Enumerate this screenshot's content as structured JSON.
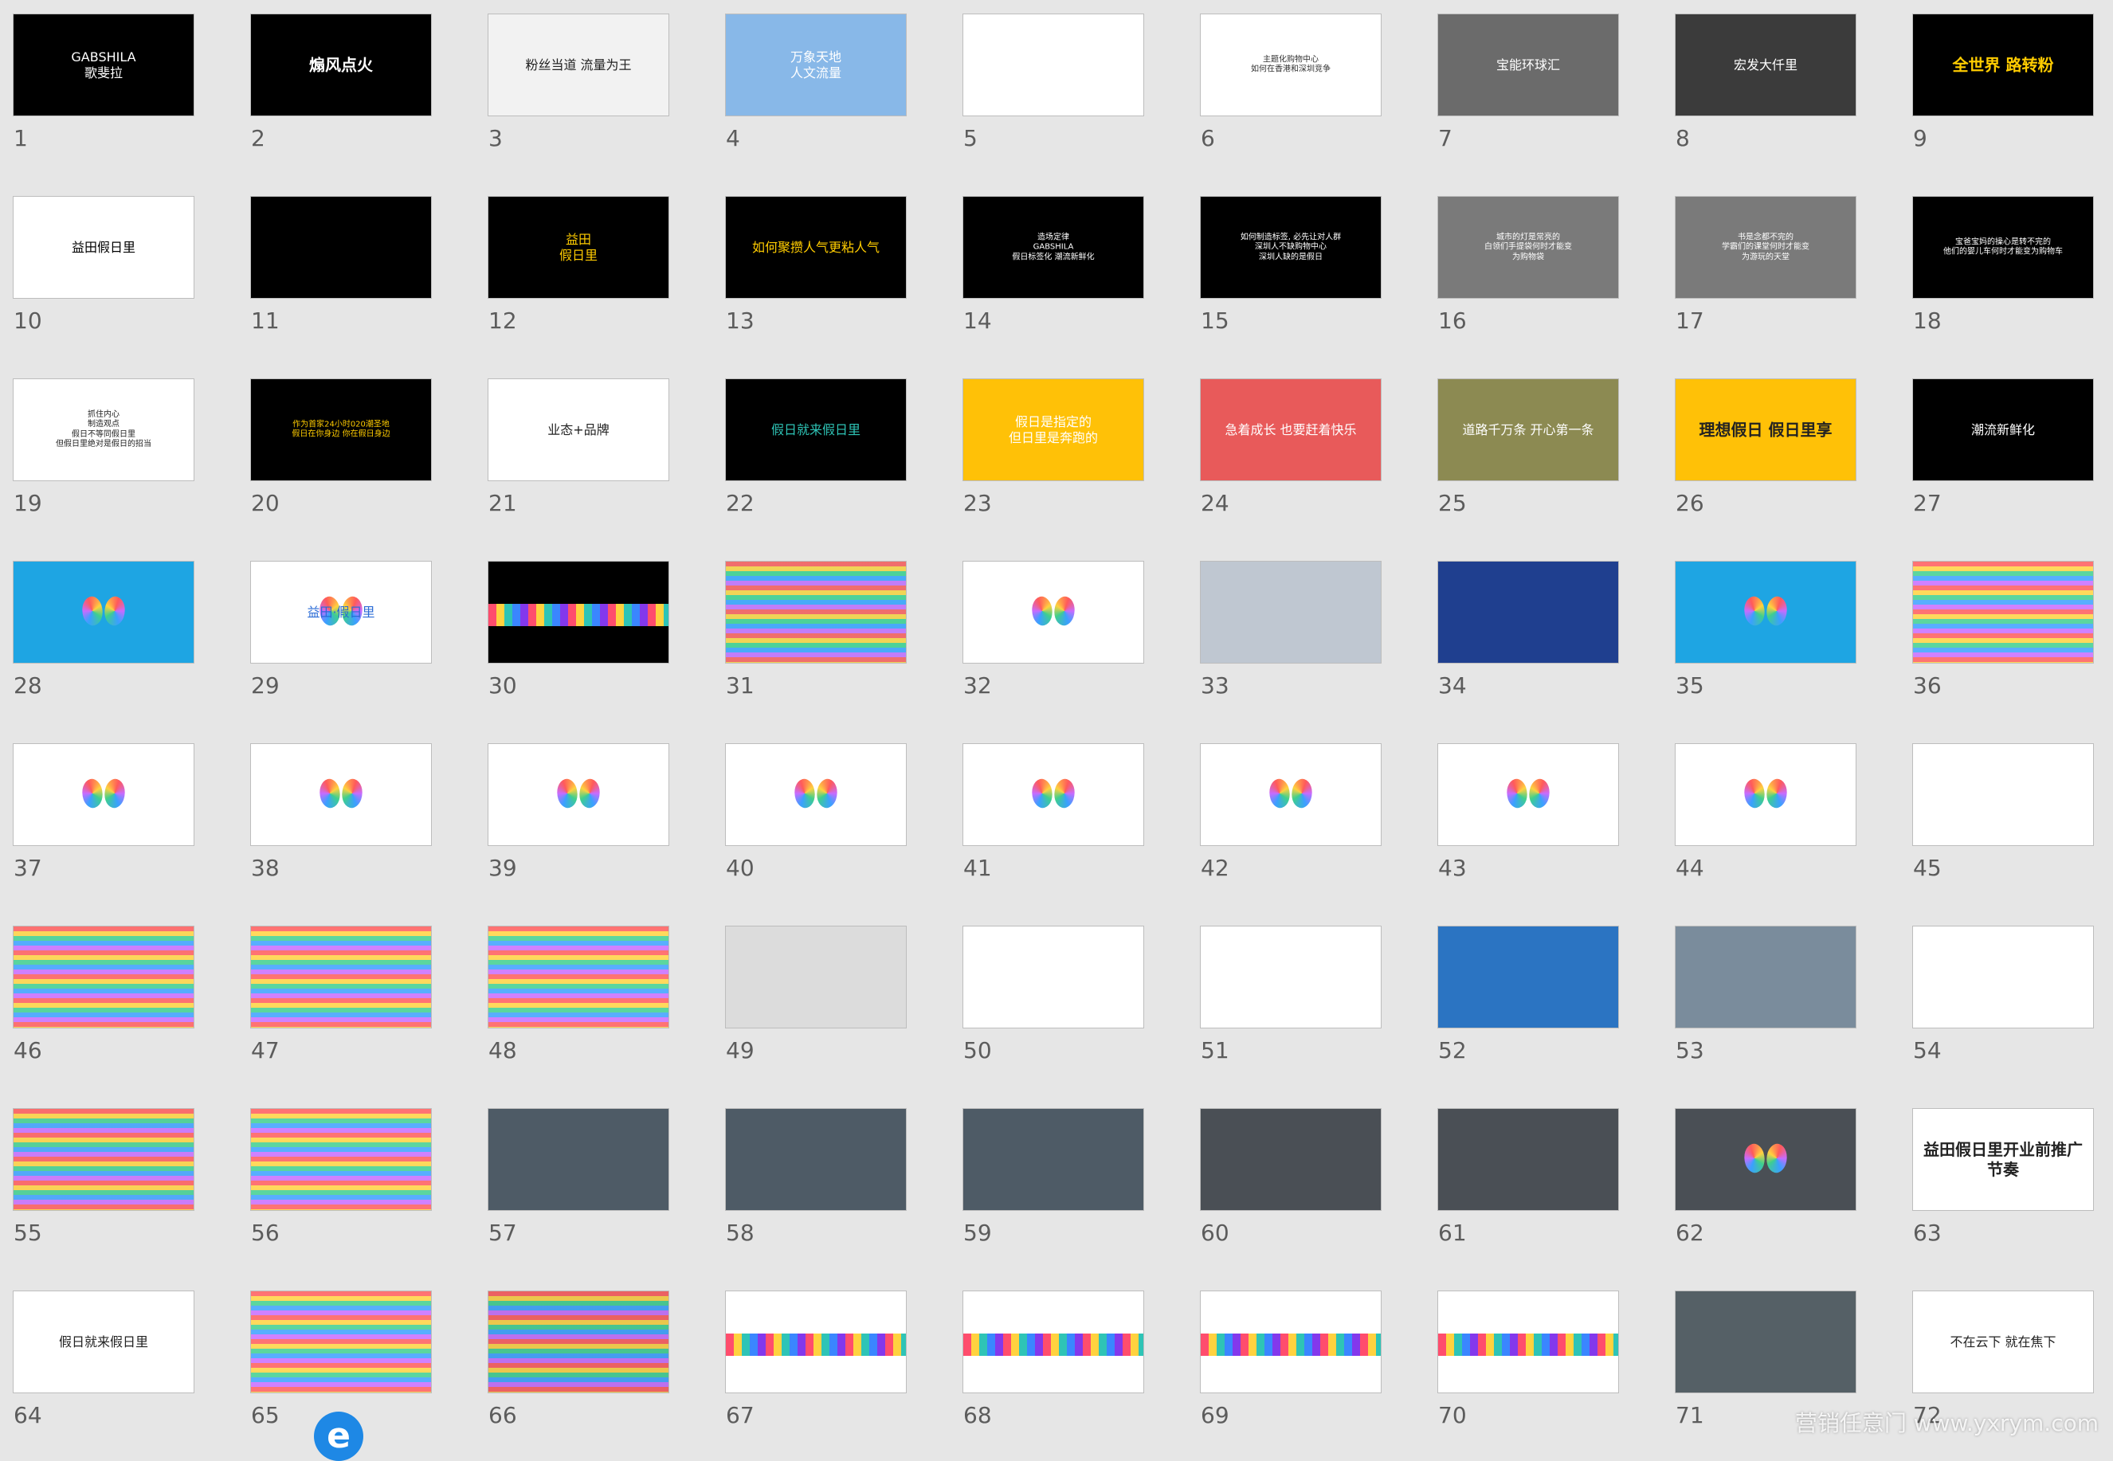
{
  "watermark": "营销任意门 www.yxrym.com",
  "e_badge": "e",
  "slides": [
    {
      "n": "1",
      "bg": "#000000",
      "fg": "#ffffff",
      "text": "GABSHILA\n歌斐拉"
    },
    {
      "n": "2",
      "bg": "#000000",
      "fg": "#ffffff",
      "text": "煽风点火"
    },
    {
      "n": "3",
      "bg": "#f2f2f2",
      "fg": "#222222",
      "text": "粉丝当道  流量为王"
    },
    {
      "n": "4",
      "bg": "#88b8e8",
      "fg": "#ffffff",
      "text": "万象天地\n人文流量"
    },
    {
      "n": "5",
      "bg": "#ffffff",
      "fg": "#333333",
      "text": ""
    },
    {
      "n": "6",
      "bg": "#ffffff",
      "fg": "#333333",
      "text": "主题化购物中心\n如何在香港和深圳竞争"
    },
    {
      "n": "7",
      "bg": "#6b6b6b",
      "fg": "#ffffff",
      "text": "宝能环球汇"
    },
    {
      "n": "8",
      "bg": "#3b3b3b",
      "fg": "#ffffff",
      "text": "宏发大仟里"
    },
    {
      "n": "9",
      "bg": "#000000",
      "fg": "#ffcc00",
      "text": "全世界  路转粉"
    },
    {
      "n": "10",
      "bg": "#ffffff",
      "fg": "#000000",
      "text": "益田假日里"
    },
    {
      "n": "11",
      "bg": "#000000",
      "fg": "#ffffff",
      "text": ""
    },
    {
      "n": "12",
      "bg": "#000000",
      "fg": "#ffcc00",
      "text": "益田\n假日里"
    },
    {
      "n": "13",
      "bg": "#000000",
      "fg": "#ffcc00",
      "text": "如何聚攒人气更粘人气"
    },
    {
      "n": "14",
      "bg": "#000000",
      "fg": "#ffffff",
      "text": "造场定律\nGABSHILA\n假日标签化     潮流新鲜化"
    },
    {
      "n": "15",
      "bg": "#000000",
      "fg": "#ffffff",
      "text": "如何制造标签, 必先让对人群\n深圳人不缺购物中心\n深圳人缺的是假日"
    },
    {
      "n": "16",
      "bg": "#7a7a7a",
      "fg": "#ffffff",
      "text": "城市的灯是常亮的\n白领们手提袋何时才能变\n为购物袋"
    },
    {
      "n": "17",
      "bg": "#7a7a7a",
      "fg": "#ffffff",
      "text": "书是念都不完的\n学霸们的课堂何时才能变\n为游玩的天堂"
    },
    {
      "n": "18",
      "bg": "#000000",
      "fg": "#ffffff",
      "text": "宝爸宝妈的操心是转不完的\n他们的婴儿车何时才能变为购物车"
    },
    {
      "n": "19",
      "bg": "#ffffff",
      "fg": "#222222",
      "text": "抓住内心\n制造观点\n假日不等同假日里\n但假日里绝对是假日的招当"
    },
    {
      "n": "20",
      "bg": "#000000",
      "fg": "#ffcc00",
      "text": "作为首家24小时020潮圣地\n假日在你身边    你在假日身边"
    },
    {
      "n": "21",
      "bg": "#ffffff",
      "fg": "#222222",
      "text": "业态+品牌"
    },
    {
      "n": "22",
      "bg": "#000000",
      "fg": "#2ec4b6",
      "text": "假日就来假日里"
    },
    {
      "n": "23",
      "bg": "#ffc107",
      "fg": "#ffffff",
      "text": "假日是指定的\n但日里是奔跑的"
    },
    {
      "n": "24",
      "bg": "#e85a5a",
      "fg": "#ffffff",
      "text": "急着成长 也要赶着快乐"
    },
    {
      "n": "25",
      "bg": "#8c8a52",
      "fg": "#ffffff",
      "text": "道路千万条 开心第一条"
    },
    {
      "n": "26",
      "bg": "#ffc107",
      "fg": "#222222",
      "text": "理想假日  假日里享"
    },
    {
      "n": "27",
      "bg": "#000000",
      "fg": "#ffffff",
      "text": "潮流新鲜化"
    },
    {
      "n": "28",
      "bg": "#1ea5e3",
      "fg": "#ffffff",
      "text": ""
    },
    {
      "n": "29",
      "bg": "#ffffff",
      "fg": "#2a6bd6",
      "text": "益田·假日里"
    },
    {
      "n": "30",
      "bg": "#000000",
      "fg": "#ffffff",
      "text": ""
    },
    {
      "n": "31",
      "bg": "#9be3d6",
      "fg": "#ffffff",
      "text": ""
    },
    {
      "n": "32",
      "bg": "#ffffff",
      "fg": "#ffffff",
      "text": ""
    },
    {
      "n": "33",
      "bg": "#bfc7d1",
      "fg": "#ffffff",
      "text": ""
    },
    {
      "n": "34",
      "bg": "#1f3f8f",
      "fg": "#ffffff",
      "text": ""
    },
    {
      "n": "35",
      "bg": "#1ea5e3",
      "fg": "#ffffff",
      "text": ""
    },
    {
      "n": "36",
      "bg": "#ffffff",
      "fg": "#ffffff",
      "text": ""
    },
    {
      "n": "37",
      "bg": "#ffffff",
      "fg": "#999999",
      "text": ""
    },
    {
      "n": "38",
      "bg": "#ffffff",
      "fg": "#999999",
      "text": ""
    },
    {
      "n": "39",
      "bg": "#ffffff",
      "fg": "#999999",
      "text": ""
    },
    {
      "n": "40",
      "bg": "#ffffff",
      "fg": "#999999",
      "text": ""
    },
    {
      "n": "41",
      "bg": "#ffffff",
      "fg": "#999999",
      "text": ""
    },
    {
      "n": "42",
      "bg": "#ffffff",
      "fg": "#999999",
      "text": ""
    },
    {
      "n": "43",
      "bg": "#ffffff",
      "fg": "#999999",
      "text": ""
    },
    {
      "n": "44",
      "bg": "#ffffff",
      "fg": "#999999",
      "text": ""
    },
    {
      "n": "45",
      "bg": "#ffffff",
      "fg": "#999999",
      "text": ""
    },
    {
      "n": "46",
      "bg": "#eef2f6",
      "fg": "#333333",
      "text": ""
    },
    {
      "n": "47",
      "bg": "#ffffff",
      "fg": "#333333",
      "text": ""
    },
    {
      "n": "48",
      "bg": "#ffffff",
      "fg": "#333333",
      "text": ""
    },
    {
      "n": "49",
      "bg": "#dcdcdc",
      "fg": "#333333",
      "text": ""
    },
    {
      "n": "50",
      "bg": "#ffffff",
      "fg": "#333333",
      "text": ""
    },
    {
      "n": "51",
      "bg": "#ffffff",
      "fg": "#333333",
      "text": ""
    },
    {
      "n": "52",
      "bg": "#2b74c2",
      "fg": "#ffffff",
      "text": ""
    },
    {
      "n": "53",
      "bg": "#7a8c9c",
      "fg": "#ffffff",
      "text": ""
    },
    {
      "n": "54",
      "bg": "#ffffff",
      "fg": "#999999",
      "text": ""
    },
    {
      "n": "55",
      "bg": "#d9d9d9",
      "fg": "#333333",
      "text": ""
    },
    {
      "n": "56",
      "bg": "#ffffff",
      "fg": "#333333",
      "text": ""
    },
    {
      "n": "57",
      "bg": "#4e5b66",
      "fg": "#ffffff",
      "text": ""
    },
    {
      "n": "58",
      "bg": "#4e5b66",
      "fg": "#ffffff",
      "text": ""
    },
    {
      "n": "59",
      "bg": "#4e5b66",
      "fg": "#ffffff",
      "text": ""
    },
    {
      "n": "60",
      "bg": "#4a4f55",
      "fg": "#ffffff",
      "text": ""
    },
    {
      "n": "61",
      "bg": "#4a4f55",
      "fg": "#ffffff",
      "text": ""
    },
    {
      "n": "62",
      "bg": "#4a4f55",
      "fg": "#ffffff",
      "text": ""
    },
    {
      "n": "63",
      "bg": "#ffffff",
      "fg": "#222222",
      "text": "益田假日里开业前推广节奏"
    },
    {
      "n": "64",
      "bg": "#ffffff",
      "fg": "#222222",
      "text": "假日就来假日里"
    },
    {
      "n": "65",
      "bg": "#ffffff",
      "fg": "#333333",
      "text": ""
    },
    {
      "n": "66",
      "bg": "#7a8a94",
      "fg": "#ffffff",
      "text": ""
    },
    {
      "n": "67",
      "bg": "#ffffff",
      "fg": "#333333",
      "text": ""
    },
    {
      "n": "68",
      "bg": "#ffffff",
      "fg": "#333333",
      "text": ""
    },
    {
      "n": "69",
      "bg": "#ffffff",
      "fg": "#333333",
      "text": ""
    },
    {
      "n": "70",
      "bg": "#ffffff",
      "fg": "#333333",
      "text": ""
    },
    {
      "n": "71",
      "bg": "#556066",
      "fg": "#ffffff",
      "text": ""
    },
    {
      "n": "72",
      "bg": "#ffffff",
      "fg": "#222222",
      "text": "不在云下  就在焦下"
    }
  ]
}
